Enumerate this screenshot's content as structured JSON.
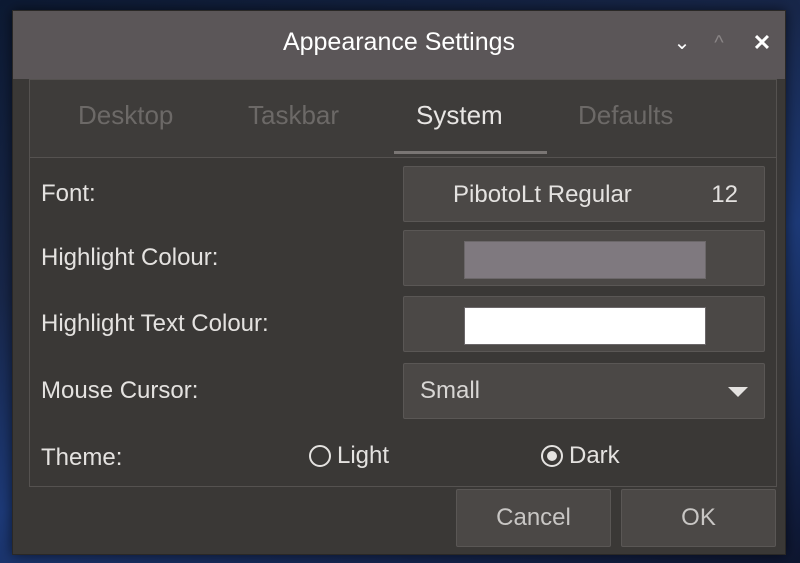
{
  "window": {
    "title": "Appearance Settings",
    "minimize_glyph": "⌄",
    "maximize_glyph": "^",
    "close_glyph": "✕"
  },
  "tabs": [
    {
      "label": "Desktop",
      "active": false
    },
    {
      "label": "Taskbar",
      "active": false
    },
    {
      "label": "System",
      "active": true
    },
    {
      "label": "Defaults",
      "active": false
    }
  ],
  "rows": {
    "font_label": "Font:",
    "font_name": "PibotoLt Regular",
    "font_size": "12",
    "highlight_colour_label": "Highlight Colour:",
    "highlight_colour": "#7f797f",
    "highlight_text_colour_label": "Highlight Text Colour:",
    "highlight_text_colour": "#ffffff",
    "mouse_cursor_label": "Mouse Cursor:",
    "mouse_cursor_value": "Small",
    "theme_label": "Theme:",
    "theme_options": [
      {
        "label": "Light",
        "selected": false
      },
      {
        "label": "Dark",
        "selected": true
      }
    ]
  },
  "footer": {
    "cancel_label": "Cancel",
    "ok_label": "OK"
  }
}
